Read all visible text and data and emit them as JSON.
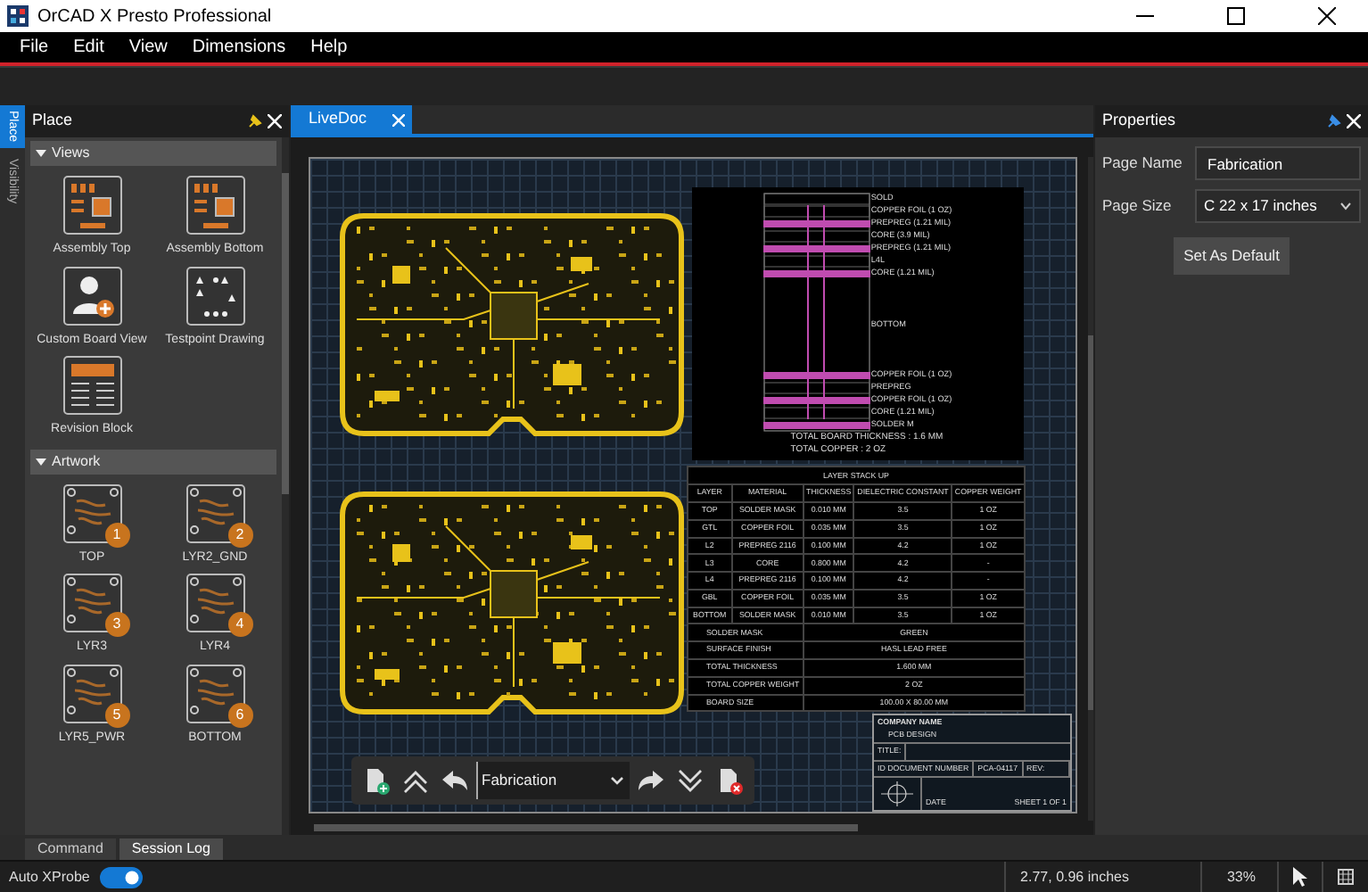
{
  "window": {
    "title": "OrCAD X Presto Professional"
  },
  "menu": [
    "File",
    "Edit",
    "View",
    "Dimensions",
    "Help"
  ],
  "side_tabs": [
    {
      "label": "Place",
      "selected": true
    },
    {
      "label": "Visibility",
      "selected": false
    }
  ],
  "place_panel": {
    "title": "Place",
    "sections": [
      {
        "title": "Views",
        "expanded": true,
        "items": [
          {
            "label": "Assembly Top",
            "kind": "assembly"
          },
          {
            "label": "Assembly Bottom",
            "kind": "assembly"
          },
          {
            "label": "Custom Board View",
            "kind": "custom"
          },
          {
            "label": "Testpoint Drawing",
            "kind": "testpoint"
          },
          {
            "label": "Revision Block",
            "kind": "revision"
          }
        ]
      },
      {
        "title": "Artwork",
        "expanded": true,
        "items": [
          {
            "label": "TOP",
            "kind": "artwork",
            "badge": "1"
          },
          {
            "label": "LYR2_GND",
            "kind": "artwork",
            "badge": "2"
          },
          {
            "label": "LYR3",
            "kind": "artwork",
            "badge": "3"
          },
          {
            "label": "LYR4",
            "kind": "artwork",
            "badge": "4"
          },
          {
            "label": "LYR5_PWR",
            "kind": "artwork",
            "badge": "5"
          },
          {
            "label": "BOTTOM",
            "kind": "artwork",
            "badge": "6"
          }
        ]
      }
    ]
  },
  "document_tabs": [
    {
      "label": "LiveDoc",
      "selected": true
    }
  ],
  "stackup_diagram": {
    "layers": [
      {
        "label": "SOLD",
        "kind": "plain"
      },
      {
        "label": "COPPER FOIL (1 OZ)",
        "kind": "plain"
      },
      {
        "label": "PREPREG (1.21 MIL)",
        "kind": "bar"
      },
      {
        "label": "CORE (3.9 MIL)",
        "kind": "plain"
      },
      {
        "label": "PREPREG (1.21 MIL)",
        "kind": "bar"
      },
      {
        "label": "L4L",
        "kind": "plain"
      },
      {
        "label": "CORE (1.21 MIL)",
        "kind": "bar"
      },
      {
        "label": "BOTTOM",
        "kind": "core"
      },
      {
        "label": "COPPER FOIL (1 OZ)",
        "kind": "bar"
      },
      {
        "label": "PREPREG",
        "kind": "plain"
      },
      {
        "label": "COPPER FOIL (1 OZ)",
        "kind": "bar"
      },
      {
        "label": "CORE (1.21 MIL)",
        "kind": "plain"
      },
      {
        "label": "SOLDER M",
        "kind": "bar"
      }
    ],
    "totals": [
      "TOTAL BOARD THICKNESS : 1.6 MM",
      "TOTAL COPPER : 2 OZ"
    ]
  },
  "stackup_table": {
    "title": "LAYER STACK UP",
    "columns": [
      "LAYER",
      "MATERIAL",
      "THICKNESS",
      "DIELECTRIC CONSTANT",
      "COPPER WEIGHT"
    ],
    "rows": [
      [
        "TOP",
        "SOLDER MASK",
        "0.010 MM",
        "3.5",
        "1 OZ"
      ],
      [
        "GTL",
        "COPPER FOIL",
        "0.035 MM",
        "3.5",
        "1 OZ"
      ],
      [
        "L2",
        "PREPREG 2116",
        "0.100 MM",
        "4.2",
        "1 OZ"
      ],
      [
        "L3",
        "CORE",
        "0.800 MM",
        "4.2",
        "-"
      ],
      [
        "L4",
        "PREPREG 2116",
        "0.100 MM",
        "4.2",
        "-"
      ],
      [
        "GBL",
        "COPPER FOIL",
        "0.035 MM",
        "3.5",
        "1 OZ"
      ],
      [
        "BOTTOM",
        "SOLDER MASK",
        "0.010 MM",
        "3.5",
        "1 OZ"
      ]
    ],
    "summary": [
      [
        "SOLDER MASK",
        "GREEN"
      ],
      [
        "SURFACE FINISH",
        "HASL LEAD FREE"
      ],
      [
        "TOTAL THICKNESS",
        "1.600 MM"
      ],
      [
        "TOTAL COPPER WEIGHT",
        "2 OZ"
      ],
      [
        "BOARD SIZE",
        "100.00 X 80.00 MM"
      ]
    ]
  },
  "title_block": {
    "company": "COMPANY NAME",
    "subtitle": "PCB DESIGN",
    "title_label": "TITLE:",
    "document_label": "ID DOCUMENT NUMBER",
    "document_number": "PCA-04117",
    "rev_label": "REV:",
    "date_label": "DATE",
    "sheet": "SHEET 1 OF 1"
  },
  "doc_toolbar": {
    "page": "Fabrication"
  },
  "properties": {
    "title": "Properties",
    "fields": [
      {
        "label": "Page Name",
        "kind": "text",
        "value": "Fabrication"
      },
      {
        "label": "Page Size",
        "kind": "select",
        "value": "C 22 x 17 inches"
      }
    ],
    "button": "Set As Default"
  },
  "bottom_tabs": [
    {
      "label": "Command",
      "selected": false
    },
    {
      "label": "Session Log",
      "selected": true
    }
  ],
  "status_bar": {
    "auto_xprobe": {
      "label": "Auto XProbe",
      "on": true
    },
    "coordinates": "2.77, 0.96 inches",
    "zoom": "33%"
  }
}
